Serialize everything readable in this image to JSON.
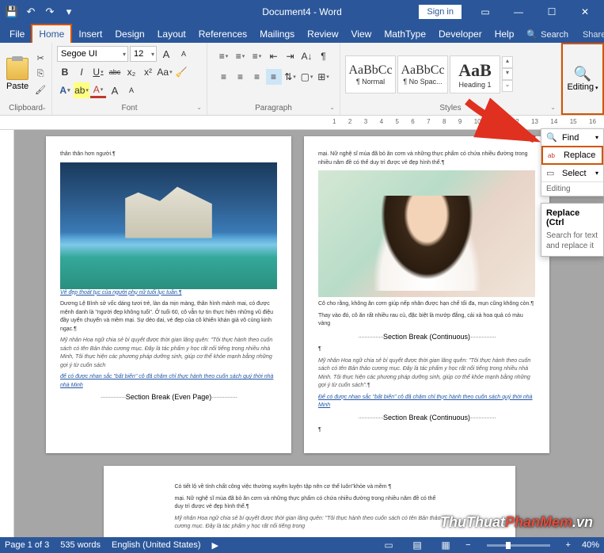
{
  "title": "Document4 - Word",
  "qat": {
    "save": "💾",
    "undo": "↶",
    "redo": "↷",
    "custom": "▾"
  },
  "signin": "Sign in",
  "win": {
    "ribbonopts": "▭",
    "min": "—",
    "max": "☐",
    "close": "✕"
  },
  "tabs": [
    "File",
    "Home",
    "Insert",
    "Design",
    "Layout",
    "References",
    "Mailings",
    "Review",
    "View",
    "MathType",
    "Developer",
    "Help"
  ],
  "tellme": {
    "icon": "🔍",
    "label": "Search"
  },
  "share": "Share",
  "ribbon": {
    "clipboard": {
      "paste": "Paste",
      "label": "Clipboard",
      "cut": "✂",
      "copy": "⎘",
      "fmt": "🖌"
    },
    "font": {
      "name": "Segoe UI",
      "size": "12",
      "grow": "A",
      "shrink": "A",
      "case": "Aa",
      "clear": "🧹",
      "bold": "B",
      "italic": "I",
      "underline": "U",
      "strike": "abc",
      "sub": "x₂",
      "sup": "x²",
      "effects": "A",
      "highlight": "ab",
      "color": "A",
      "label": "Font"
    },
    "para": {
      "bullets": "≡",
      "numbers": "≡",
      "multilevel": "≡",
      "indL": "⇤",
      "indR": "⇥",
      "sort": "A↓",
      "marks": "¶",
      "alignL": "≡",
      "alignC": "≡",
      "alignR": "≡",
      "alignJ": "≡",
      "spacing": "⇅",
      "shade": "▢",
      "borders": "⊞",
      "label": "Paragraph"
    },
    "styles": {
      "normal": {
        "preview": "AaBbCc",
        "name": "¶ Normal"
      },
      "nospace": {
        "preview": "AaBbCc",
        "name": "¶ No Spac..."
      },
      "h1": {
        "preview": "AaB",
        "name": "Heading 1"
      },
      "label": "Styles"
    },
    "editing": {
      "icon": "🔍",
      "label": "Editing"
    }
  },
  "ruler_nums": [
    "1",
    "2",
    "3",
    "4",
    "5",
    "6",
    "7",
    "8",
    "9",
    "10",
    "11",
    "12",
    "13",
    "14",
    "15",
    "16"
  ],
  "flyout": {
    "find": {
      "icon": "🔍",
      "label": "Find"
    },
    "replace": {
      "icon": "ab",
      "label": "Replace"
    },
    "select": {
      "icon": "▭",
      "label": "Select"
    },
    "header": "Editing"
  },
  "tooltip": {
    "title": "Replace (Ctrl",
    "body": "Search for text and replace it"
  },
  "doc": {
    "left": {
      "top_frag": "thân thân hơn người.¶",
      "caption": "Vẻ đẹp thoát tục của người phụ nữ tuổi lục tuần.¶",
      "p1": "Dương Lệ Bình sở vốc dáng tươi trẻ, làn da mịn màng, thân hình mảnh mai, có được mệnh danh là \"người đẹp không tuổi\". Ở tuổi 60, cô vẫn tự tin thực hiện những vũ điệu đầy uyển chuyển và mềm mại. Sự dẻo dai, vẻ đẹp của cô khiến khán giả vô cùng kinh ngạc.¶",
      "p2": "Mỹ nhân Hoa ngữ chia sẻ bí quyết được thời gian lãng quên: \"Tôi thực hành theo cuốn sách có tên Bản thảo cương mục. Đây là tác phẩm y học rất nổi tiếng trong nhiều nhà Minh, Tôi thực hiện các phương pháp dưỡng sinh, giúp cơ thể khỏe mạnh bằng những gợi ý từ cuốn sách",
      "link1": "để có được nhan sắc \"bất biến\" cô đã chăm chỉ thực hành theo cuốn sách quý thời nhà nhà Minh",
      "break": "Section Break (Even Page)"
    },
    "right": {
      "top_frag": "mại. Nữ nghệ sĩ mùa đã bỏ ăn cơm và những thực phẩm có chứa nhiều đường trong nhiều năm đề có thể duy trì được vẻ đẹp hình thể.¶",
      "p1": "Cô cho rằng, không ăn cơm giúp nếp nhăn được hạn chế tối đa, mụn cũng không còn.¶",
      "p2": "Thay vào đó, cô ăn rất nhiều rau củ, đặc biệt là mướp đắng, cải xà hoa quả có màu vàng",
      "break1": "Section Break (Continuous)",
      "pnum": "¶",
      "p3": "Mỹ nhân Hoa ngữ chia sẻ bí quyết được thời gian lãng quên: \"Tôi thực hành theo cuốn sách có tên Bản thảo cương mục. Đây là tác phẩm y học rất nổi tiếng trong nhiều nhà Minh. Tôi thực hiện các phương pháp dưỡng sinh, giúp cơ thể khỏe mạnh bằng những gợi ý từ cuốn sách\".¶",
      "link2": "Để có được nhan sắc \"bất biến\" cô đã chăm chỉ thực hành theo cuốn sách quý thời nhà Minh",
      "break2": "Section Break (Continuous)",
      "pnum2": "¶"
    },
    "bottom": {
      "p1": "Có tiết lộ về tính chất công việc thường xuyên luyện tập nên cơ thể luôn\"khỏe và mềm ¶",
      "p2": "mại. Nữ nghệ sĩ mùa đã bỏ ăn cơm và những thực phẩm có chứa nhiều đường trong nhiều năm đề có thể duy trì được vẻ đẹp hình thể.¶",
      "p3": "Mỹ nhân Hoa ngữ chia sẻ bí quyết được thời gian lãng quên: \"Tôi thực hành theo cuốn sách có tên Bản thảo cương mục. Đây là tác phẩm y học rất nổi tiếng trong"
    }
  },
  "status": {
    "page": "Page 1 of 3",
    "words": "535 words",
    "lang": "English (United States)",
    "zoom_minus": "−",
    "zoom_plus": "+",
    "zoom": "40%"
  },
  "watermark": {
    "a": "ThuThuat",
    "b": "PhanMem",
    "c": ".vn"
  }
}
